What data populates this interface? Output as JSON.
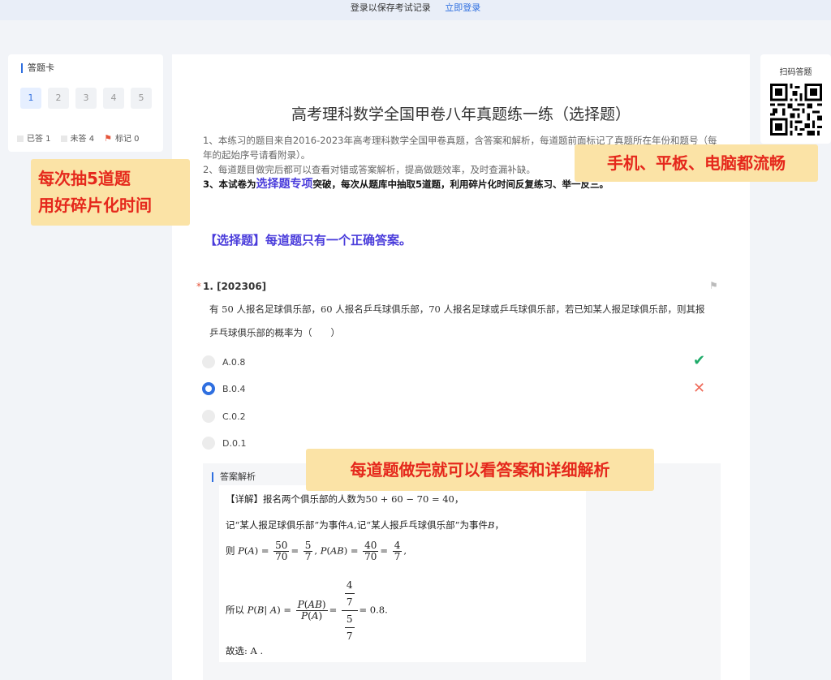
{
  "topbar": {
    "prompt": "登录以保存考试记录",
    "login_link": "立即登录"
  },
  "answer_card": {
    "title": "答题卡",
    "numbers": [
      "1",
      "2",
      "3",
      "4",
      "5"
    ],
    "active_number": "1",
    "legend": {
      "answered": "已答 1",
      "unanswered": "未答 4",
      "flagged": "标记 0"
    }
  },
  "qr": {
    "title": "扫码答题"
  },
  "main": {
    "title": "高考理科数学全国甲卷八年真题练一练（选择题）",
    "intro": [
      "1、本练习的题目来自2016-2023年高考理科数学全国甲卷真题，含答案和解析，每道题前面标记了真题所在年份和题号（每年的起始序号请看附录）。",
      "2、每道题目做完后都可以查看对错或答案解析，提高做题效率，及时查漏补缺。"
    ],
    "intro3": {
      "prefix": "3、本试卷为",
      "highlight": "选择题专项",
      "suffix": "突破，每次从题库中抽取5道题，利用碎片化时间反复练习、举一反三。"
    },
    "section_title": "【选择题】每道题只有一个正确答案。"
  },
  "question": {
    "required_mark": "*",
    "title": "1. [202306]",
    "text": "有 50 人报名足球俱乐部，60 人报名乒乓球俱乐部，70 人报名足球或乒乓球俱乐部，若已知某人报足球俱乐部，则其报乒乓球俱乐部的概率为（　　）",
    "options": [
      {
        "label": "A.0.8",
        "selected": false,
        "mark": "correct"
      },
      {
        "label": "B.0.4",
        "selected": true,
        "mark": "wrong"
      },
      {
        "label": "C.0.2",
        "selected": false,
        "mark": ""
      },
      {
        "label": "D.0.1",
        "selected": false,
        "mark": ""
      }
    ],
    "correct_glyph": "✔",
    "wrong_glyph": "✕"
  },
  "analysis": {
    "title": "答案解析",
    "line1": "【详解】报名两个俱乐部的人数为50 + 60 − 70 = 40，",
    "line2_a": "记“某人报足球俱乐部”为事件",
    "line2_b": "A",
    "line2_c": ",记“某人报乒乓球俱乐部”为事件",
    "line2_d": "B",
    "line2_e": "，",
    "line3_prefix": "则",
    "line4_prefix": "所以",
    "conclusion": "故选: A ."
  },
  "banners": {
    "left": [
      "每次抽5道题",
      "用好碎片化时间"
    ],
    "right": "手机、平板、电脑都流畅",
    "bottom": "每道题做完就可以看答案和详细解析"
  },
  "colors": {
    "accent": "#2f6fe0",
    "highlight": "#4a3cdb",
    "banner_bg": "#fbe3a6",
    "banner_text": "#e5281c",
    "correct": "#1fab6a",
    "wrong": "#ef6b5a"
  },
  "icons": {
    "flag": "flag-icon",
    "qr": "qr-code-icon",
    "check": "check-icon",
    "cross": "cross-icon"
  }
}
